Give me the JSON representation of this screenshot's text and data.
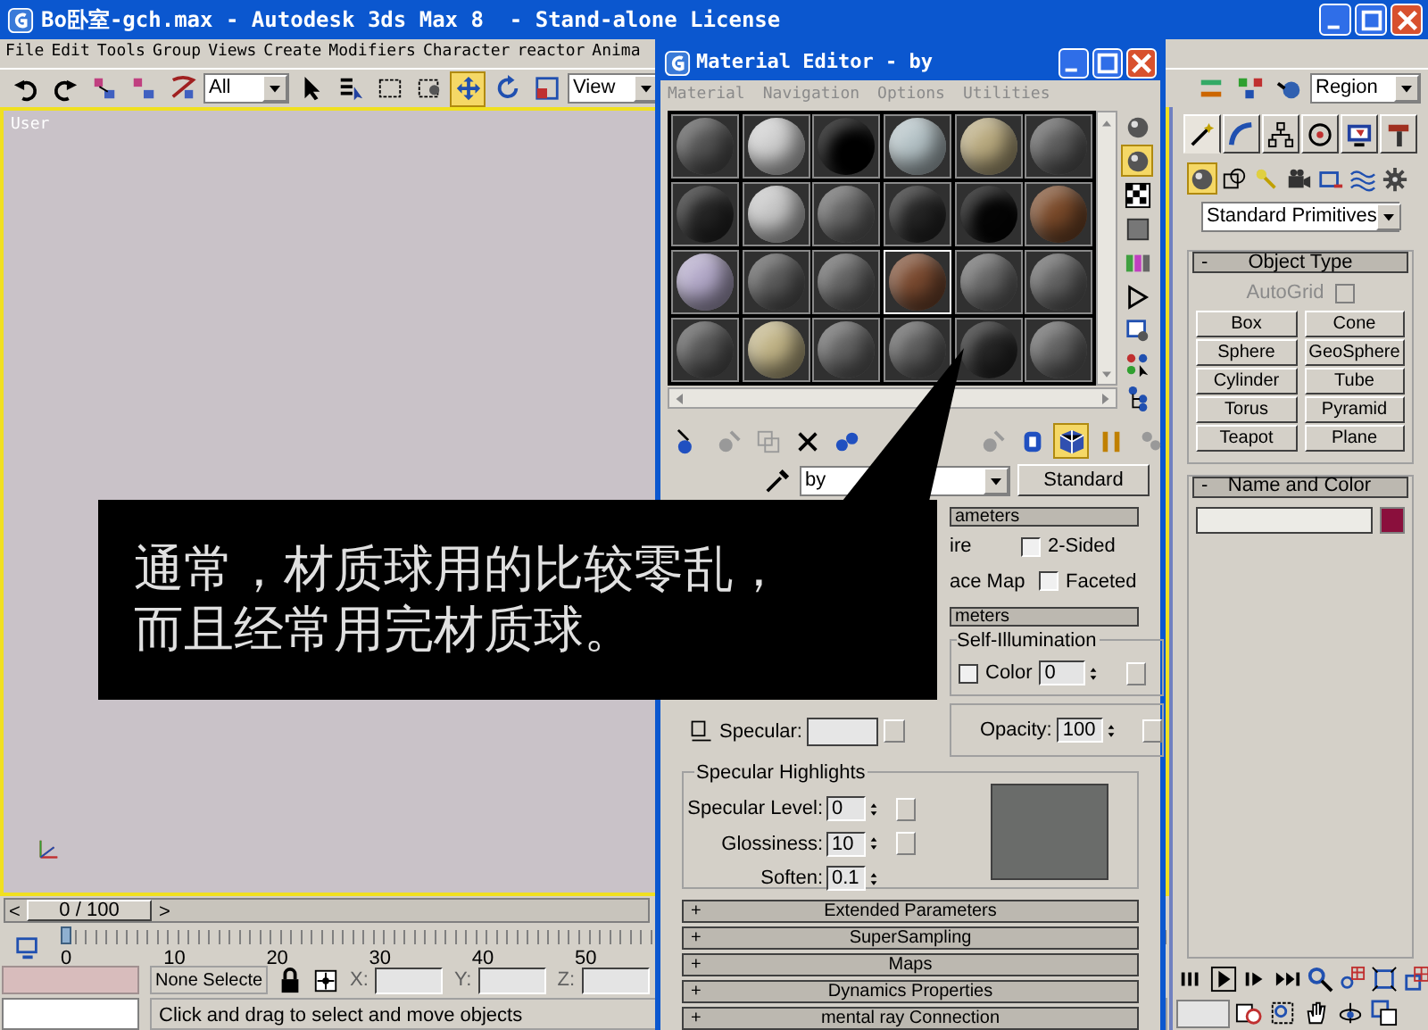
{
  "window": {
    "title": "Bo卧室-gch.max - Autodesk 3ds Max 8  - Stand-alone License"
  },
  "menu": [
    "File",
    "Edit",
    "Tools",
    "Group",
    "Views",
    "Create",
    "Modifiers",
    "Character",
    "reactor",
    "Anima"
  ],
  "toolbar": {
    "selection_filter": "All",
    "reference_coord": "View",
    "selection_region": "Region",
    "tools": [
      {
        "selected": false
      },
      {
        "selected": false
      },
      {
        "selected": false
      },
      {
        "selected": false
      },
      {
        "selected": true
      },
      {
        "selected": false
      },
      {
        "selected": false
      }
    ]
  },
  "viewport": {
    "label": "User"
  },
  "time_slider": {
    "prev": "<",
    "frame": "0 / 100",
    "next": ">",
    "level": 0
  },
  "track_bar": {
    "ticks": [
      "0",
      "10",
      "20",
      "30",
      "40",
      "50"
    ]
  },
  "status": {
    "selection": "None Selecte",
    "x_label": "X:",
    "y_label": "Y:",
    "z_label": "Z:",
    "prompt": "Click and drag to select and move objects"
  },
  "material_editor": {
    "title": "Material Editor - by",
    "menu": [
      "Material",
      "Navigation",
      "Options",
      "Utilities"
    ],
    "slots": [
      {
        "color": "#555555",
        "selected": false
      },
      {
        "color": "#cfcfcf",
        "selected": false
      },
      {
        "color": "#000000",
        "selected": false
      },
      {
        "color": "#b4c2c6",
        "selected": false
      },
      {
        "color": "#b8a97e",
        "selected": false
      },
      {
        "color": "#5e5e5e",
        "selected": false
      },
      {
        "color": "#262626",
        "selected": false
      },
      {
        "color": "#c6c6c6",
        "selected": false
      },
      {
        "color": "#666666",
        "selected": false
      },
      {
        "color": "#262626",
        "selected": false
      },
      {
        "color": "#050505",
        "selected": false
      },
      {
        "color": "#7a4a2a",
        "selected": false
      },
      {
        "color": "#b2a8c8",
        "selected": false
      },
      {
        "color": "#5c5c5c",
        "selected": false
      },
      {
        "color": "#646464",
        "selected": false
      },
      {
        "color": "#7a4a30",
        "selected": true
      },
      {
        "color": "#686868",
        "selected": false
      },
      {
        "color": "#646464",
        "selected": false
      },
      {
        "color": "#585858",
        "selected": false
      },
      {
        "color": "#c0b386",
        "selected": false
      },
      {
        "color": "#646464",
        "selected": false
      },
      {
        "color": "#5e5e5e",
        "selected": false
      },
      {
        "color": "#262626",
        "selected": false
      },
      {
        "color": "#646464",
        "selected": false
      }
    ],
    "side_tools": [
      {
        "selected": false
      },
      {
        "selected": true
      },
      {
        "selected": false
      },
      {
        "selected": false
      },
      {
        "selected": false
      },
      {
        "selected": false
      },
      {
        "selected": false
      },
      {
        "selected": false
      },
      {
        "selected": false
      }
    ],
    "bottom_tools": [
      {
        "selected": false
      },
      {
        "selected": false
      },
      {
        "selected": false
      },
      {
        "selected": false
      },
      {
        "selected": false
      },
      {
        "selected": false
      },
      {
        "selected": false
      },
      {
        "selected": true
      },
      {
        "selected": false
      },
      {
        "selected": false
      }
    ],
    "material_name": "by",
    "material_type": "Standard",
    "shader_rollout": "ameters",
    "wire": "ire",
    "two_sided": {
      "label": "2-Sided",
      "checked": false
    },
    "face_map": "ace Map",
    "faceted": {
      "label": "Faceted",
      "checked": false
    },
    "blinn_rollout": "meters",
    "self_illumination": {
      "title": "Self-Illumination",
      "color_label": "Color",
      "value": "0",
      "checked": false
    },
    "specular_label": "Specular:",
    "opacity": {
      "label": "Opacity:",
      "value": "100"
    },
    "specular_highlights": {
      "title": "Specular Highlights",
      "fields": [
        {
          "label": "Specular Level:",
          "value": "0"
        },
        {
          "label": "Glossiness:",
          "value": "10"
        },
        {
          "label": "Soften:",
          "value": "0.1"
        }
      ]
    },
    "rollouts": [
      {
        "sign": "+",
        "title": "Extended Parameters"
      },
      {
        "sign": "+",
        "title": "SuperSampling"
      },
      {
        "sign": "+",
        "title": "Maps"
      },
      {
        "sign": "+",
        "title": "Dynamics Properties"
      },
      {
        "sign": "+",
        "title": "mental ray Connection"
      }
    ]
  },
  "command_panel": {
    "tabs": [
      {
        "selected": true
      },
      {
        "selected": false
      },
      {
        "selected": false
      },
      {
        "selected": false
      },
      {
        "selected": false
      },
      {
        "selected": false
      }
    ],
    "categories": [
      {
        "selected": true
      },
      {
        "selected": false
      },
      {
        "selected": false
      },
      {
        "selected": false
      },
      {
        "selected": false
      },
      {
        "selected": false
      },
      {
        "selected": false
      }
    ],
    "dropdown": "Standard Primitives",
    "object_type": {
      "sign": "-",
      "title": "Object Type",
      "autogrid": {
        "label": "AutoGrid",
        "checked": false,
        "disabled": true
      },
      "buttons": [
        "Box",
        "Cone",
        "Sphere",
        "GeoSphere",
        "Cylinder",
        "Tube",
        "Torus",
        "Pyramid",
        "Teapot",
        "Plane"
      ]
    },
    "name_and_color": {
      "sign": "-",
      "title": "Name and Color",
      "color": "#8a0f3c"
    }
  },
  "caption": {
    "lines": [
      "通常，材质球用的比较零乱，",
      "而且经常用完材质球。"
    ]
  }
}
